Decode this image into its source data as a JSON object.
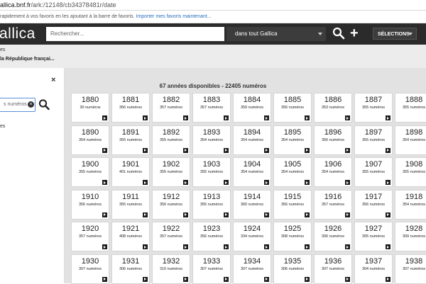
{
  "browser": {
    "url_host": "allica.bnf.fr",
    "url_path": "/ark:/12148/cb34378481r/date",
    "fav_text": "rapidement à vos favoris en les ajoutant à la barre de favoris.",
    "fav_link": "Importer mes favoris maintenant..."
  },
  "header": {
    "logo": "allica",
    "search_placeholder": "Rechercher...",
    "scope": "dans tout Gallica",
    "plus": "+",
    "selections": "SÉLECTIONS"
  },
  "breadcrumb": {
    "line1": "es",
    "line2": "la République françai..."
  },
  "leftpanel": {
    "close": "×",
    "search_value": "s numéros",
    "clear": "×",
    "link": "es"
  },
  "main": {
    "title": "67 années disponibles - 22405 numéros",
    "years": [
      {
        "year": "1880",
        "count": "30 numéros"
      },
      {
        "year": "1881",
        "count": "356 numéros"
      },
      {
        "year": "1882",
        "count": "357 numéros"
      },
      {
        "year": "1883",
        "count": "357 numéros"
      },
      {
        "year": "1884",
        "count": "359 numéros"
      },
      {
        "year": "1885",
        "count": "356 numéros"
      },
      {
        "year": "1886",
        "count": "353 numéros"
      },
      {
        "year": "1887",
        "count": "355 numéros"
      },
      {
        "year": "1888",
        "count": "355 numéros"
      },
      {
        "year": "1890",
        "count": "354 numéros"
      },
      {
        "year": "1891",
        "count": "355 numéros"
      },
      {
        "year": "1892",
        "count": "355 numéros"
      },
      {
        "year": "1893",
        "count": "354 numéros"
      },
      {
        "year": "1894",
        "count": "354 numéros"
      },
      {
        "year": "1895",
        "count": "354 numéros"
      },
      {
        "year": "1896",
        "count": "356 numéros"
      },
      {
        "year": "1897",
        "count": "355 numéros"
      },
      {
        "year": "1898",
        "count": "354 numéros"
      },
      {
        "year": "1900",
        "count": "355 numéros"
      },
      {
        "year": "1901",
        "count": "401 numéros"
      },
      {
        "year": "1902",
        "count": "355 numéros"
      },
      {
        "year": "1903",
        "count": "355 numéros"
      },
      {
        "year": "1904",
        "count": "354 numéros"
      },
      {
        "year": "1905",
        "count": "354 numéros"
      },
      {
        "year": "1906",
        "count": "354 numéros"
      },
      {
        "year": "1907",
        "count": "355 numéros"
      },
      {
        "year": "1908",
        "count": "355 numéros"
      },
      {
        "year": "1910",
        "count": "356 numéros"
      },
      {
        "year": "1911",
        "count": "355 numéros"
      },
      {
        "year": "1912",
        "count": "356 numéros"
      },
      {
        "year": "1913",
        "count": "355 numéros"
      },
      {
        "year": "1914",
        "count": "360 numéros"
      },
      {
        "year": "1915",
        "count": "356 numéros"
      },
      {
        "year": "1916",
        "count": "357 numéros"
      },
      {
        "year": "1917",
        "count": "356 numéros"
      },
      {
        "year": "1918",
        "count": "354 numéros"
      },
      {
        "year": "1920",
        "count": "357 numéros"
      },
      {
        "year": "1921",
        "count": "408 numéros"
      },
      {
        "year": "1922",
        "count": "357 numéros"
      },
      {
        "year": "1923",
        "count": "356 numéros"
      },
      {
        "year": "1924",
        "count": "334 numéros"
      },
      {
        "year": "1925",
        "count": "308 numéros"
      },
      {
        "year": "1926",
        "count": "306 numéros"
      },
      {
        "year": "1927",
        "count": "305 numéros"
      },
      {
        "year": "1928",
        "count": "309 numéros"
      },
      {
        "year": "1930",
        "count": "307 numéros"
      },
      {
        "year": "1931",
        "count": "306 numéros"
      },
      {
        "year": "1932",
        "count": "310 numéros"
      },
      {
        "year": "1933",
        "count": "307 numéros"
      },
      {
        "year": "1934",
        "count": "307 numéros"
      },
      {
        "year": "1935",
        "count": "306 numéros"
      },
      {
        "year": "1936",
        "count": "307 numéros"
      },
      {
        "year": "1937",
        "count": "304 numéros"
      },
      {
        "year": "1938",
        "count": "307 numéros"
      }
    ]
  }
}
